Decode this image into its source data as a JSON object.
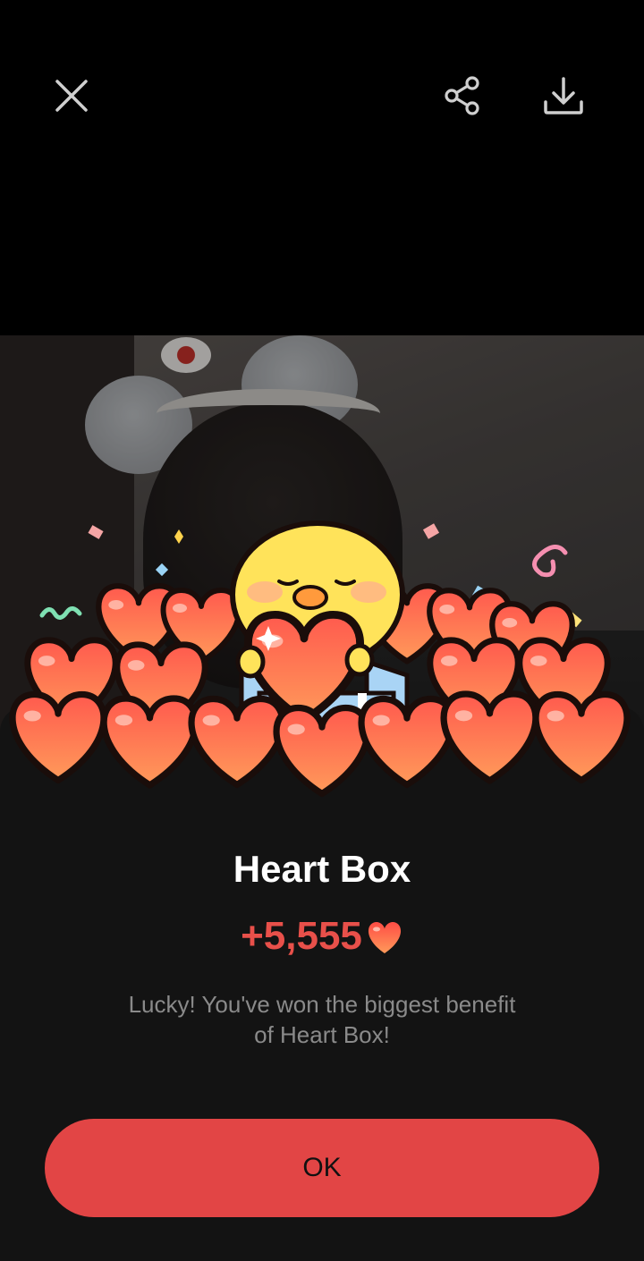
{
  "toolbar": {
    "close_icon": "close-icon",
    "share_icon": "share-icon",
    "download_icon": "download-icon"
  },
  "reward": {
    "title": "Heart Box",
    "amount": "+5,555",
    "amount_icon": "heart-icon",
    "message_line1": "Lucky! You've won the biggest benefit",
    "message_line2": "of Heart Box!"
  },
  "ok_label": "OK",
  "colors": {
    "accent": "#e24545",
    "amount": "#e8504a",
    "sheet_bg": "#131313",
    "message": "#8a8a8a"
  }
}
